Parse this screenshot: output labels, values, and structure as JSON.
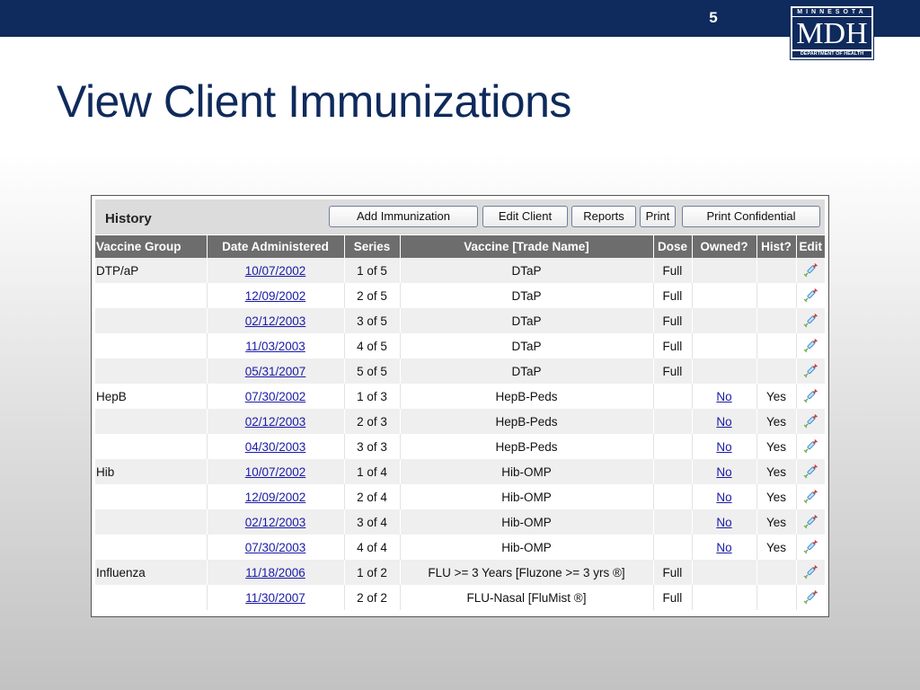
{
  "slide": {
    "number": "5",
    "title": "View Client Immunizations"
  },
  "logo": {
    "top": "MINNESOTA",
    "main": "MDH",
    "bottom": "DEPARTMENT OF HEALTH"
  },
  "panel": {
    "title": "History",
    "buttons": {
      "add_immunization": "Add Immunization",
      "edit_client": "Edit Client",
      "reports": "Reports",
      "print": "Print",
      "print_confidential": "Print Confidential"
    }
  },
  "columns": [
    "Vaccine Group",
    "Date Administered",
    "Series",
    "Vaccine [Trade Name]",
    "Dose",
    "Owned?",
    "Hist?",
    "Edit"
  ],
  "rows": [
    {
      "group": "DTP/aP",
      "date": "10/07/2002",
      "series": "1 of 5",
      "vaccine": "DTaP",
      "dose": "Full",
      "owned": "",
      "hist": ""
    },
    {
      "group": "",
      "date": "12/09/2002",
      "series": "2 of 5",
      "vaccine": "DTaP",
      "dose": "Full",
      "owned": "",
      "hist": ""
    },
    {
      "group": "",
      "date": "02/12/2003",
      "series": "3 of 5",
      "vaccine": "DTaP",
      "dose": "Full",
      "owned": "",
      "hist": ""
    },
    {
      "group": "",
      "date": "11/03/2003",
      "series": "4 of 5",
      "vaccine": "DTaP",
      "dose": "Full",
      "owned": "",
      "hist": ""
    },
    {
      "group": "",
      "date": "05/31/2007",
      "series": "5 of 5",
      "vaccine": "DTaP",
      "dose": "Full",
      "owned": "",
      "hist": ""
    },
    {
      "group": "HepB",
      "date": "07/30/2002",
      "series": "1 of 3",
      "vaccine": "HepB-Peds",
      "dose": "",
      "owned": "No",
      "hist": "Yes"
    },
    {
      "group": "",
      "date": "02/12/2003",
      "series": "2 of 3",
      "vaccine": "HepB-Peds",
      "dose": "",
      "owned": "No",
      "hist": "Yes"
    },
    {
      "group": "",
      "date": "04/30/2003",
      "series": "3 of 3",
      "vaccine": "HepB-Peds",
      "dose": "",
      "owned": "No",
      "hist": "Yes"
    },
    {
      "group": "Hib",
      "date": "10/07/2002",
      "series": "1 of 4",
      "vaccine": "Hib-OMP",
      "dose": "",
      "owned": "No",
      "hist": "Yes"
    },
    {
      "group": "",
      "date": "12/09/2002",
      "series": "2 of 4",
      "vaccine": "Hib-OMP",
      "dose": "",
      "owned": "No",
      "hist": "Yes"
    },
    {
      "group": "",
      "date": "02/12/2003",
      "series": "3 of 4",
      "vaccine": "Hib-OMP",
      "dose": "",
      "owned": "No",
      "hist": "Yes"
    },
    {
      "group": "",
      "date": "07/30/2003",
      "series": "4 of 4",
      "vaccine": "Hib-OMP",
      "dose": "",
      "owned": "No",
      "hist": "Yes"
    },
    {
      "group": "Influenza",
      "date": "11/18/2006",
      "series": "1 of 2",
      "vaccine": "FLU >= 3 Years [Fluzone >= 3 yrs ®]",
      "dose": "Full",
      "owned": "",
      "hist": ""
    },
    {
      "group": "",
      "date": "11/30/2007",
      "series": "2 of 2",
      "vaccine": "FLU-Nasal [FluMist ®]",
      "dose": "Full",
      "owned": "",
      "hist": ""
    }
  ],
  "edit_icon": "syringe-icon",
  "colors": {
    "brand_navy": "#0f2a5c",
    "header_gray": "#6d6d6d",
    "link_blue": "#1a1aa6"
  }
}
